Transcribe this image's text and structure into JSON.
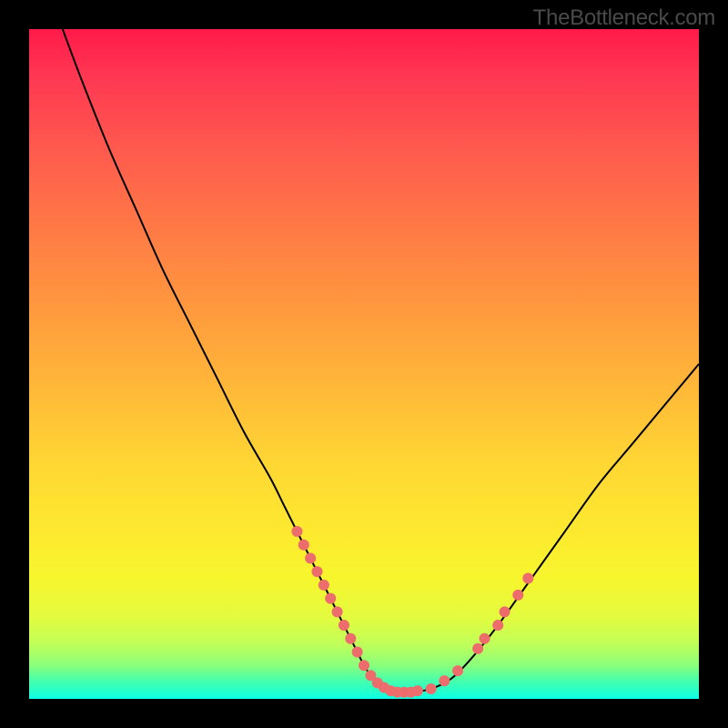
{
  "attribution": "TheBottleneck.com",
  "colors": {
    "frame_border": "#000000",
    "gradient_top": "#ff1a4a",
    "gradient_bottom": "#0cffe8",
    "curve_stroke": "#000000",
    "marker_fill": "#ed6c6c",
    "marker_stroke": "#ed6c6c"
  },
  "chart_data": {
    "type": "line",
    "title": "",
    "xlabel": "",
    "ylabel": "",
    "xlim": [
      0,
      100
    ],
    "ylim": [
      0,
      100
    ],
    "series": [
      {
        "name": "bottleneck-curve",
        "x": [
          5,
          8,
          12,
          16,
          20,
          24,
          28,
          32,
          36,
          38,
          40,
          42,
          44,
          46,
          48,
          49,
          50,
          51,
          52,
          53,
          55,
          57,
          60,
          63,
          66,
          70,
          75,
          80,
          85,
          90,
          95,
          100
        ],
        "y": [
          100,
          92,
          82,
          73,
          64,
          56,
          48,
          40,
          33,
          29,
          25,
          21,
          17,
          13,
          9,
          7,
          5,
          3.5,
          2.4,
          1.7,
          1,
          1,
          1.5,
          3,
          6,
          11,
          18,
          25,
          32,
          38,
          44,
          50
        ]
      }
    ],
    "markers": {
      "name": "highlighted-points",
      "points": [
        {
          "x": 40,
          "y": 25
        },
        {
          "x": 41,
          "y": 23
        },
        {
          "x": 42,
          "y": 21
        },
        {
          "x": 43,
          "y": 19
        },
        {
          "x": 44,
          "y": 17
        },
        {
          "x": 45,
          "y": 15
        },
        {
          "x": 46,
          "y": 13
        },
        {
          "x": 47,
          "y": 11
        },
        {
          "x": 48,
          "y": 9
        },
        {
          "x": 49,
          "y": 7
        },
        {
          "x": 50,
          "y": 5
        },
        {
          "x": 51,
          "y": 3.5
        },
        {
          "x": 52,
          "y": 2.4
        },
        {
          "x": 53,
          "y": 1.7
        },
        {
          "x": 54,
          "y": 1.2
        },
        {
          "x": 55,
          "y": 1
        },
        {
          "x": 56,
          "y": 1
        },
        {
          "x": 57,
          "y": 1
        },
        {
          "x": 58,
          "y": 1.2
        },
        {
          "x": 60,
          "y": 1.5
        },
        {
          "x": 62,
          "y": 2.7
        },
        {
          "x": 64,
          "y": 4.2
        },
        {
          "x": 67,
          "y": 7.5
        },
        {
          "x": 68,
          "y": 9
        },
        {
          "x": 70,
          "y": 11
        },
        {
          "x": 71,
          "y": 13
        },
        {
          "x": 73,
          "y": 15.5
        },
        {
          "x": 74.5,
          "y": 18
        }
      ]
    }
  }
}
